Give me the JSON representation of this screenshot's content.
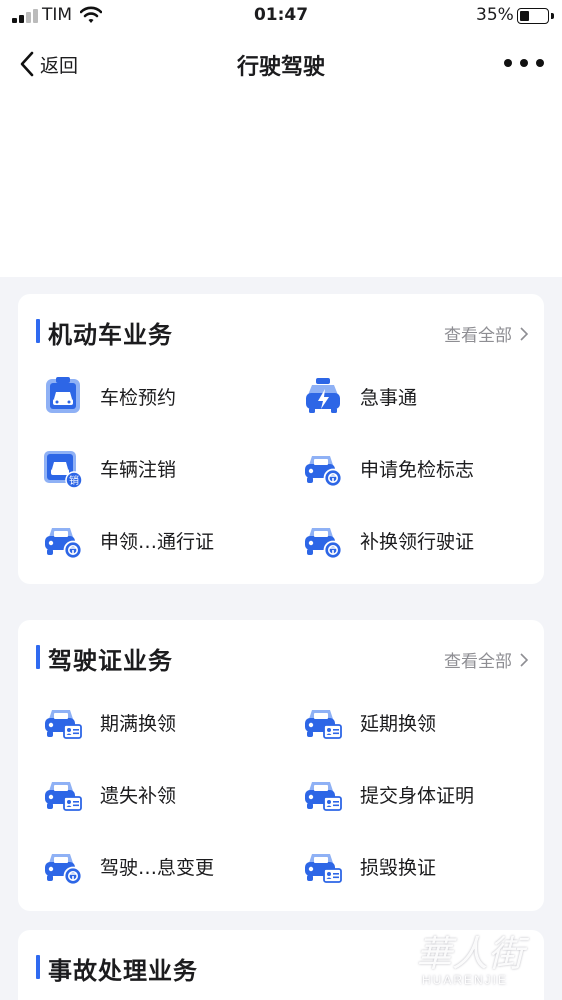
{
  "status_bar": {
    "carrier": "TIM",
    "time": "01:47",
    "battery": "35%",
    "battery_level": 0.35
  },
  "nav": {
    "back_label": "返回",
    "title": "行驶驾驶"
  },
  "sections": [
    {
      "title": "机动车业务",
      "see_all": "查看全部",
      "items": [
        {
          "label": "车检预约",
          "icon": "car-inspection-icon"
        },
        {
          "label": "急事通",
          "icon": "urgent-car-icon"
        },
        {
          "label": "车辆注销",
          "icon": "car-cancel-icon"
        },
        {
          "label": "申请免检标志",
          "icon": "car-badge-icon"
        },
        {
          "label": "申领…通行证",
          "icon": "car-badge-icon"
        },
        {
          "label": "补换领行驶证",
          "icon": "car-badge-icon"
        }
      ]
    },
    {
      "title": "驾驶证业务",
      "see_all": "查看全部",
      "items": [
        {
          "label": "期满换领",
          "icon": "car-id-card-icon"
        },
        {
          "label": "延期换领",
          "icon": "car-id-card-icon"
        },
        {
          "label": "遗失补领",
          "icon": "car-id-card-icon"
        },
        {
          "label": "提交身体证明",
          "icon": "car-id-card-icon"
        },
        {
          "label": "驾驶…息变更",
          "icon": "car-badge-icon"
        },
        {
          "label": "损毁换证",
          "icon": "car-id-card-icon"
        }
      ]
    },
    {
      "title": "事故处理业务"
    }
  ],
  "icon_badge_text": "销",
  "watermark": {
    "cn": "華人街",
    "en": "HUARENJIE"
  },
  "colors": {
    "accent": "#2f6af0",
    "icon_light": "#8fb1f5",
    "icon_dark": "#2d66e6",
    "background": "#f3f4f8"
  }
}
